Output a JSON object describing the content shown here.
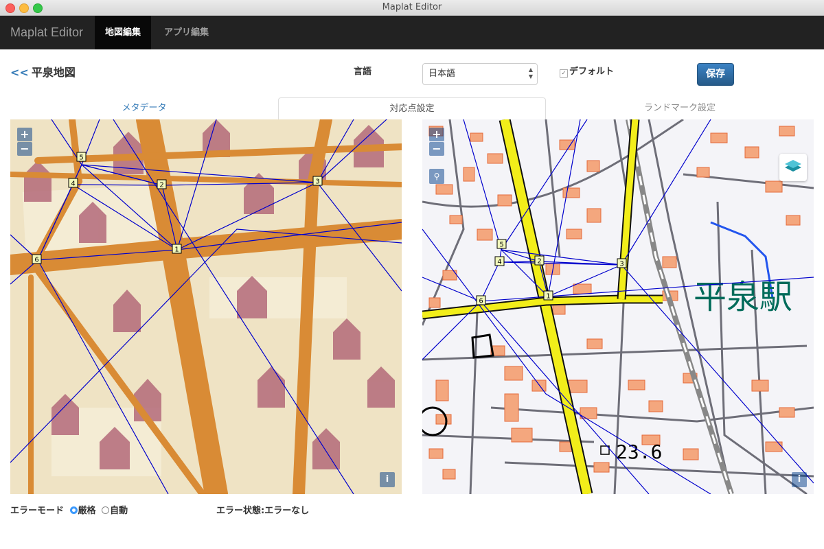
{
  "window": {
    "title": "Maplat Editor"
  },
  "navbar": {
    "brand": "Maplat Editor",
    "tabs": [
      {
        "label": "地図編集",
        "active": true
      },
      {
        "label": "アプリ編集",
        "active": false
      }
    ]
  },
  "header": {
    "back_link": "<<",
    "map_title": "平泉地図",
    "lang_label": "言語",
    "lang_value": "日本語",
    "default_label": "デフォルト",
    "save_label": "保存"
  },
  "tabs": [
    {
      "label": "メタデータ"
    },
    {
      "label": "対応点設定",
      "active": true
    },
    {
      "label": "ランドマーク設定"
    }
  ],
  "map_controls": {
    "zoom_in": "+",
    "zoom_out": "−",
    "info": "i"
  },
  "gcp_labels": [
    "1",
    "2",
    "3",
    "4",
    "5",
    "6"
  ],
  "right_map": {
    "station_label": "平泉駅",
    "elevation_label": "23.6"
  },
  "footer": {
    "error_mode_label": "エラーモード",
    "mode_strict": "厳格",
    "mode_auto": "自動",
    "error_status": "エラー状態:エラーなし"
  },
  "colors": {
    "accent": "#337ab7",
    "navbar": "#222222",
    "triangle_line": "#0000cc",
    "road_yellow": "#f2ee1a",
    "building": "#f4a77e"
  }
}
